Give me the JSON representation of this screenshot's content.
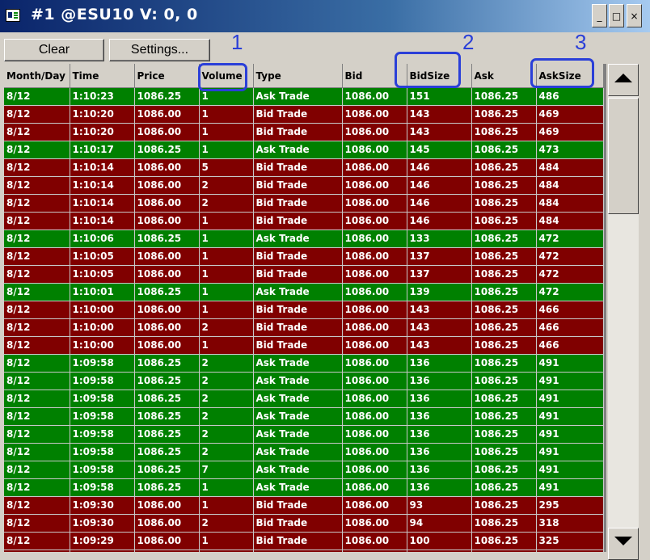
{
  "window": {
    "title": "#1 @ESU10   V: 0, 0"
  },
  "toolbar": {
    "clear_label": "Clear",
    "settings_label": "Settings..."
  },
  "columns": [
    "Month/Day",
    "Time",
    "Price",
    "Volume",
    "Type",
    "Bid",
    "BidSize",
    "Ask",
    "AskSize"
  ],
  "annotations": [
    "1",
    "2",
    "3"
  ],
  "colors": {
    "ask_trade_row": "#008000",
    "bid_trade_row": "#800000",
    "annotation": "#2a3fd8"
  },
  "rows": [
    [
      "8/12",
      "1:10:23",
      "1086.25",
      "1",
      "Ask Trade",
      "1086.00",
      "151",
      "1086.25",
      "486"
    ],
    [
      "8/12",
      "1:10:20",
      "1086.00",
      "1",
      "Bid Trade",
      "1086.00",
      "143",
      "1086.25",
      "469"
    ],
    [
      "8/12",
      "1:10:20",
      "1086.00",
      "1",
      "Bid Trade",
      "1086.00",
      "143",
      "1086.25",
      "469"
    ],
    [
      "8/12",
      "1:10:17",
      "1086.25",
      "1",
      "Ask Trade",
      "1086.00",
      "145",
      "1086.25",
      "473"
    ],
    [
      "8/12",
      "1:10:14",
      "1086.00",
      "5",
      "Bid Trade",
      "1086.00",
      "146",
      "1086.25",
      "484"
    ],
    [
      "8/12",
      "1:10:14",
      "1086.00",
      "2",
      "Bid Trade",
      "1086.00",
      "146",
      "1086.25",
      "484"
    ],
    [
      "8/12",
      "1:10:14",
      "1086.00",
      "2",
      "Bid Trade",
      "1086.00",
      "146",
      "1086.25",
      "484"
    ],
    [
      "8/12",
      "1:10:14",
      "1086.00",
      "1",
      "Bid Trade",
      "1086.00",
      "146",
      "1086.25",
      "484"
    ],
    [
      "8/12",
      "1:10:06",
      "1086.25",
      "1",
      "Ask Trade",
      "1086.00",
      "133",
      "1086.25",
      "472"
    ],
    [
      "8/12",
      "1:10:05",
      "1086.00",
      "1",
      "Bid Trade",
      "1086.00",
      "137",
      "1086.25",
      "472"
    ],
    [
      "8/12",
      "1:10:05",
      "1086.00",
      "1",
      "Bid Trade",
      "1086.00",
      "137",
      "1086.25",
      "472"
    ],
    [
      "8/12",
      "1:10:01",
      "1086.25",
      "1",
      "Ask Trade",
      "1086.00",
      "139",
      "1086.25",
      "472"
    ],
    [
      "8/12",
      "1:10:00",
      "1086.00",
      "1",
      "Bid Trade",
      "1086.00",
      "143",
      "1086.25",
      "466"
    ],
    [
      "8/12",
      "1:10:00",
      "1086.00",
      "2",
      "Bid Trade",
      "1086.00",
      "143",
      "1086.25",
      "466"
    ],
    [
      "8/12",
      "1:10:00",
      "1086.00",
      "1",
      "Bid Trade",
      "1086.00",
      "143",
      "1086.25",
      "466"
    ],
    [
      "8/12",
      "1:09:58",
      "1086.25",
      "2",
      "Ask Trade",
      "1086.00",
      "136",
      "1086.25",
      "491"
    ],
    [
      "8/12",
      "1:09:58",
      "1086.25",
      "2",
      "Ask Trade",
      "1086.00",
      "136",
      "1086.25",
      "491"
    ],
    [
      "8/12",
      "1:09:58",
      "1086.25",
      "2",
      "Ask Trade",
      "1086.00",
      "136",
      "1086.25",
      "491"
    ],
    [
      "8/12",
      "1:09:58",
      "1086.25",
      "2",
      "Ask Trade",
      "1086.00",
      "136",
      "1086.25",
      "491"
    ],
    [
      "8/12",
      "1:09:58",
      "1086.25",
      "2",
      "Ask Trade",
      "1086.00",
      "136",
      "1086.25",
      "491"
    ],
    [
      "8/12",
      "1:09:58",
      "1086.25",
      "2",
      "Ask Trade",
      "1086.00",
      "136",
      "1086.25",
      "491"
    ],
    [
      "8/12",
      "1:09:58",
      "1086.25",
      "7",
      "Ask Trade",
      "1086.00",
      "136",
      "1086.25",
      "491"
    ],
    [
      "8/12",
      "1:09:58",
      "1086.25",
      "1",
      "Ask Trade",
      "1086.00",
      "136",
      "1086.25",
      "491"
    ],
    [
      "8/12",
      "1:09:30",
      "1086.00",
      "1",
      "Bid Trade",
      "1086.00",
      "93",
      "1086.25",
      "295"
    ],
    [
      "8/12",
      "1:09:30",
      "1086.00",
      "2",
      "Bid Trade",
      "1086.00",
      "94",
      "1086.25",
      "318"
    ],
    [
      "8/12",
      "1:09:29",
      "1086.00",
      "1",
      "Bid Trade",
      "1086.00",
      "100",
      "1086.25",
      "325"
    ],
    [
      "8/12",
      "1:09:29",
      "1086.00",
      "1",
      "Bid Trade",
      "1086.00",
      "100",
      "1086.25",
      "325"
    ]
  ]
}
